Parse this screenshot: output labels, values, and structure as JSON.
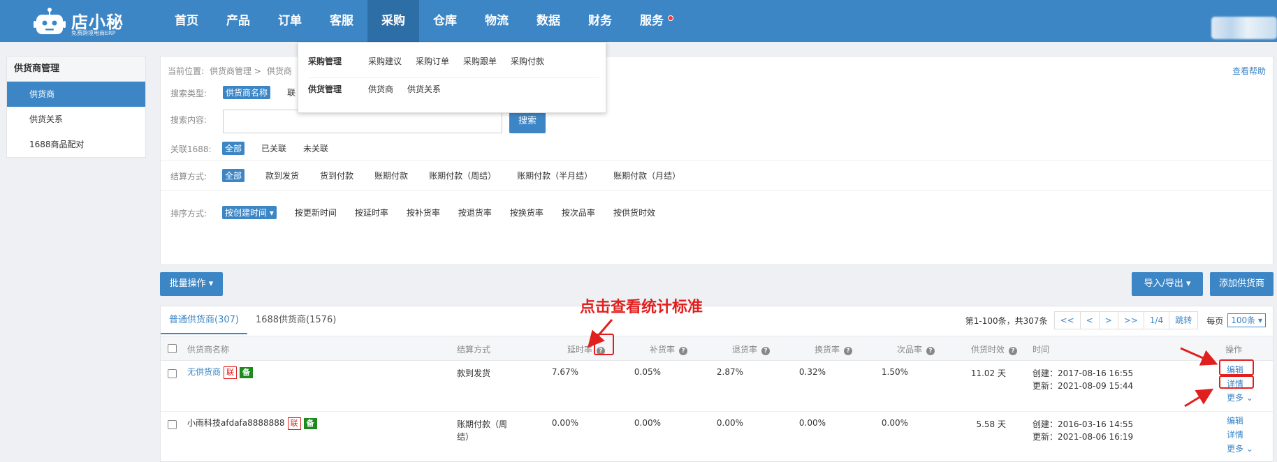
{
  "app": {
    "logo_name": "店小秘",
    "logo_sub": "免费跨境电商ERP"
  },
  "nav": [
    "首页",
    "产品",
    "订单",
    "客服",
    "采购",
    "仓库",
    "物流",
    "数据",
    "财务",
    "服务"
  ],
  "sidebar": {
    "header": "供货商管理",
    "items": [
      "供货商",
      "供货关系",
      "1688商品配对"
    ]
  },
  "dropdown": {
    "group1": {
      "title": "采购管理",
      "links": [
        "采购建议",
        "采购订单",
        "采购跟单",
        "采购付款"
      ]
    },
    "group2": {
      "title": "供货管理",
      "links": [
        "供货商",
        "供货关系"
      ]
    }
  },
  "breadcrumb": {
    "label": "当前位置:",
    "path1": "供货商管理 >",
    "path2": "供货商"
  },
  "help_link": "查看帮助",
  "filters": {
    "search_type": {
      "label": "搜索类型:",
      "options": [
        "供货商名称",
        "联"
      ]
    },
    "search_content": {
      "label": "搜索内容:",
      "button": "搜索"
    },
    "relation": {
      "label": "关联1688:",
      "options": [
        "全部",
        "已关联",
        "未关联"
      ]
    },
    "settlement": {
      "label": "结算方式:",
      "options": [
        "全部",
        "款到发货",
        "货到付款",
        "账期付款",
        "账期付款（周结）",
        "账期付款（半月结）",
        "账期付款（月结）"
      ]
    },
    "sort": {
      "label": "排序方式:",
      "options": [
        "按创建时间 ▾",
        "按更新时间",
        "按延时率",
        "按补货率",
        "按退货率",
        "按换货率",
        "按次品率",
        "按供货时效"
      ]
    }
  },
  "actions": {
    "batch": "批量操作 ▾",
    "import_export": "导入/导出 ▾",
    "add_supplier": "添加供货商"
  },
  "annotation": "点击查看统计标准",
  "tabs": [
    "普通供货商(307)",
    "1688供货商(1576)"
  ],
  "pager": {
    "summary": "第1-100条，共307条",
    "buttons": [
      "<<",
      "<",
      ">",
      ">>",
      "1/4",
      "跳转"
    ],
    "per_page_label": "每页",
    "per_page": "100条 ▾"
  },
  "table": {
    "headers": {
      "name": "供货商名称",
      "settlement": "结算方式",
      "delay": "延时率",
      "restock": "补货率",
      "return": "退货率",
      "exchange": "换货率",
      "defect": "次品率",
      "lead_time": "供货时效",
      "time": "时间",
      "ops": "操作"
    },
    "rows": [
      {
        "name": "无供货商",
        "badge1": "联",
        "badge2": "备",
        "settlement": "款到发货",
        "settlement2": "",
        "delay": "7.67%",
        "restock": "0.05%",
        "return": "2.87%",
        "exchange": "0.32%",
        "defect": "1.50%",
        "lead_time": "11.02 天",
        "created": "创建：2017-08-16 16:55",
        "updated": "更新：2021-08-09 15:44",
        "op_edit": "编辑",
        "op_detail": "详情",
        "op_more": "更多 ⌄"
      },
      {
        "name": "小雨科技afdafa8888888",
        "badge1": "联",
        "badge2": "备",
        "settlement": "账期付款（周",
        "settlement2": "结）",
        "delay": "0.00%",
        "restock": "0.00%",
        "return": "0.00%",
        "exchange": "0.00%",
        "defect": "0.00%",
        "lead_time": "5.58 天",
        "created": "创建：2016-03-16 14:55",
        "updated": "更新：2021-08-06 16:19",
        "op_edit": "编辑",
        "op_detail": "详情",
        "op_more": "更多 ⌄"
      }
    ]
  },
  "colors": {
    "primary": "#3d86c6",
    "annotation_red": "#e0201f",
    "badge_green": "#1e8a1e"
  }
}
